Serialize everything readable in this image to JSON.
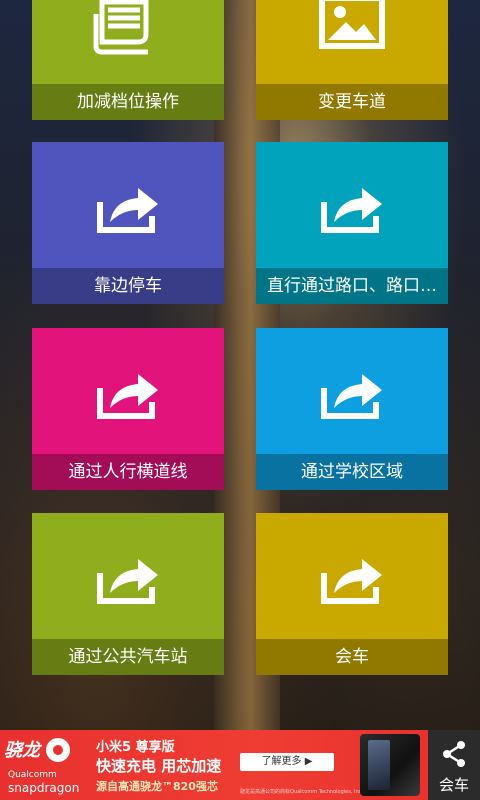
{
  "tiles": [
    {
      "label": "加减档位操作",
      "color": "#8fad1c",
      "icon": "newspaper-icon"
    },
    {
      "label": "变更车道",
      "color": "#c9a800",
      "icon": "image-icon"
    },
    {
      "label": "靠边停车",
      "color": "#4f55bd",
      "icon": "share-arrow-icon"
    },
    {
      "label": "直行通过路口、路口…",
      "color": "#00a2bc",
      "icon": "share-arrow-icon"
    },
    {
      "label": "通过人行横道线",
      "color": "#e2137b",
      "icon": "share-arrow-icon"
    },
    {
      "label": "通过学校区域",
      "color": "#0d9fe0",
      "icon": "share-arrow-icon"
    },
    {
      "label": "通过公共汽车站",
      "color": "#8fad1c",
      "icon": "share-arrow-icon"
    },
    {
      "label": "会车",
      "color": "#c9a800",
      "icon": "share-arrow-icon"
    }
  ],
  "ad": {
    "brand_zh": "骁龙",
    "brand_en_1": "Qualcomm",
    "brand_en_2": "snapdragon",
    "headline": "小米5 尊享版",
    "subline": "快速充电 用芯加速",
    "tagline": "源自高通骁龙™820强芯",
    "button": "了解更多 ▶",
    "fine_print": "骁龙是高通公司的商标Qualcomm Technologies, Inc.的产品",
    "background_color": "#e8312f"
  },
  "share": {
    "label": "会车",
    "icon": "share-icon"
  }
}
